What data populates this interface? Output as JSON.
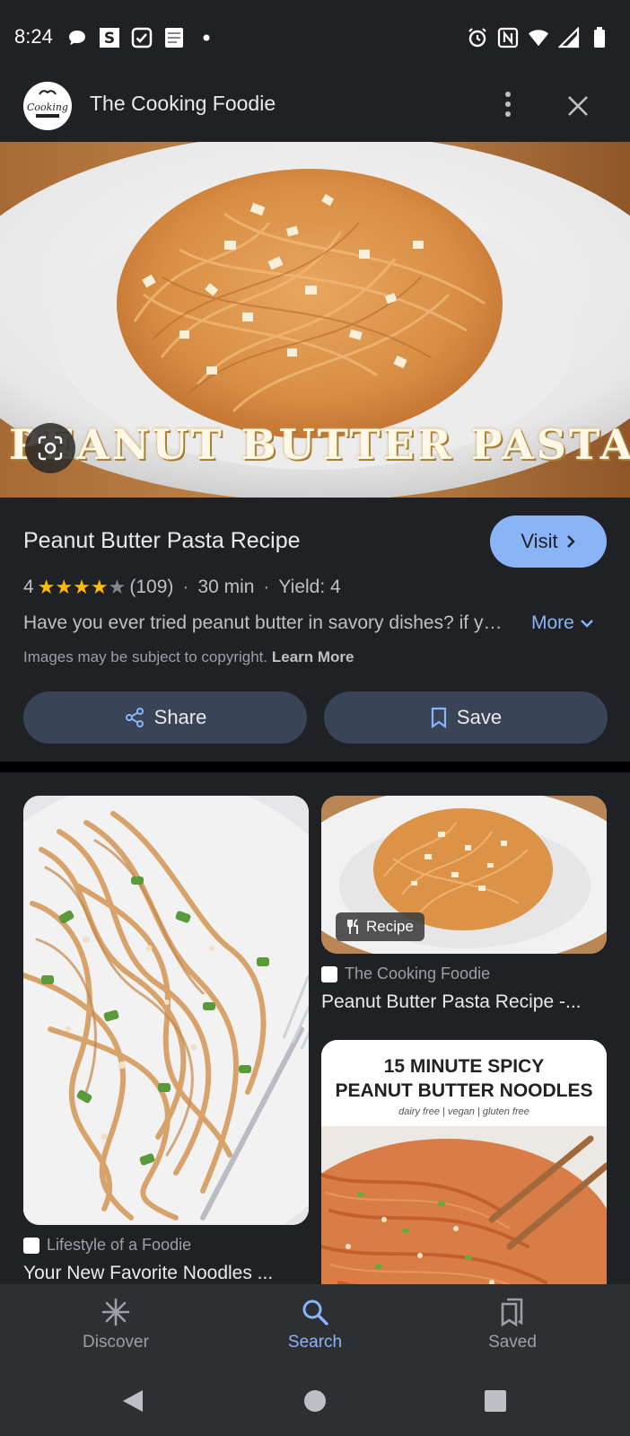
{
  "status_bar": {
    "time": "8:24"
  },
  "header": {
    "title": "The Cooking Foodie",
    "avatar_text": "Cooking"
  },
  "hero": {
    "overlay_text": "PEANUT BUTTER PASTA"
  },
  "info": {
    "title": "Peanut Butter Pasta Recipe",
    "visit_label": "Visit",
    "rating_value": "4",
    "rating_stars": 4,
    "review_count": "(109)",
    "duration": "30 min",
    "yield": "Yield: 4",
    "separator": "·",
    "description": "Have you ever tried peanut butter in savory dishes? if you haven't, you should try this recipe",
    "more_label": "More",
    "copyright_text": "Images may be subject to copyright.",
    "learn_more": "Learn More",
    "share_label": "Share",
    "save_label": "Save"
  },
  "results": [
    {
      "source": "The Cooking Foodie",
      "title": "Peanut Butter Pasta Recipe -...",
      "chip": "Recipe"
    },
    {
      "source": "Lifestyle of a Foodie",
      "title": "Your New Favorite Noodles ..."
    },
    {
      "promo_title_line1": "15 MINUTE SPICY",
      "promo_title_line2": "PEANUT BUTTER NOODLES",
      "promo_subtitle": "dairy free | vegan | gluten free"
    }
  ],
  "bottom_nav": {
    "items": [
      {
        "label": "Discover",
        "icon": "asterisk-icon",
        "active": false
      },
      {
        "label": "Search",
        "icon": "search-icon",
        "active": true
      },
      {
        "label": "Saved",
        "icon": "bookmarks-icon",
        "active": false
      }
    ]
  },
  "colors": {
    "background": "#202124",
    "accent": "#8ab4f8",
    "button_bg": "#394457",
    "star": "#fbbc04"
  }
}
